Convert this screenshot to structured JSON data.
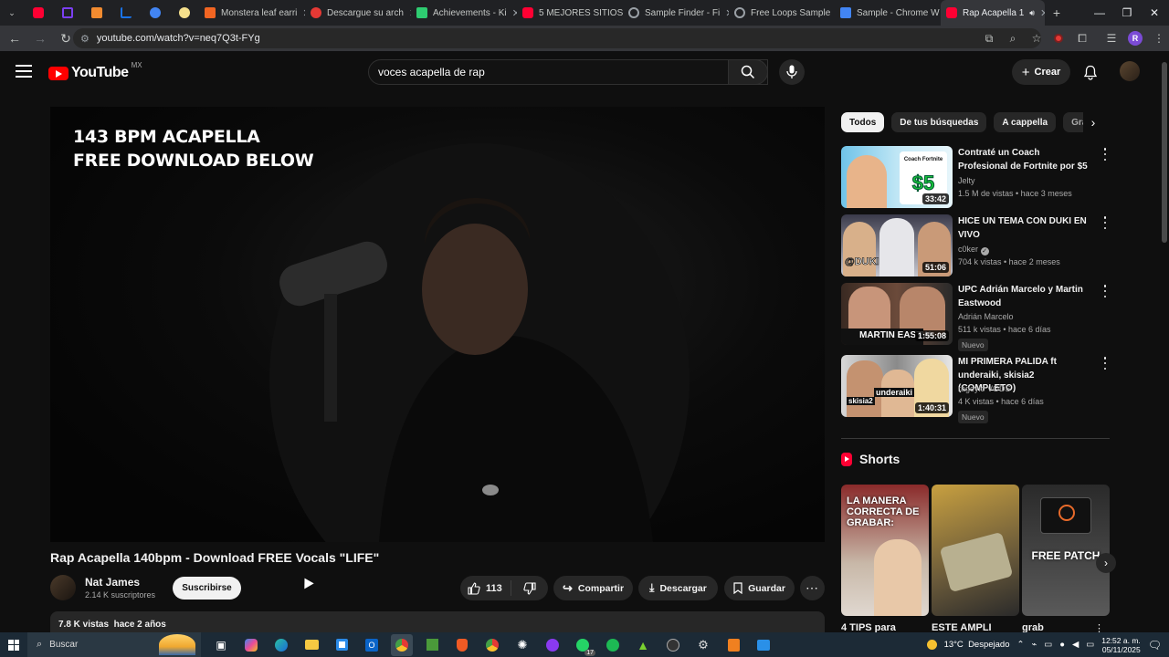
{
  "browser": {
    "tabs": [
      {
        "label": "",
        "pinned": true,
        "color": "#ff0033"
      },
      {
        "label": "",
        "pinned": true,
        "color": "#7b3ff2"
      },
      {
        "label": "",
        "pinned": true,
        "color": "#f28b30"
      },
      {
        "label": "",
        "pinned": true,
        "color": "#1a73e8"
      },
      {
        "label": "",
        "pinned": true,
        "color": "#4285f4"
      },
      {
        "label": "",
        "pinned": true,
        "color": "#f5e08c"
      },
      {
        "label": "Monstera leaf earri",
        "pinned": false,
        "color": "#f26522"
      },
      {
        "label": "Descargue su arch",
        "pinned": false,
        "color": "#e53935"
      },
      {
        "label": "Achievements - Ki",
        "pinned": false,
        "color": "#2ecc71"
      },
      {
        "label": "5 MEJORES SITIOS",
        "pinned": false,
        "color": "#ff0033"
      },
      {
        "label": "Sample Finder - Fi",
        "pinned": false,
        "color": "#9aa0a6"
      },
      {
        "label": "Free Loops Sample",
        "pinned": false,
        "color": "#9aa0a6"
      },
      {
        "label": "Sample - Chrome W",
        "pinned": false,
        "color": "#4285f4"
      },
      {
        "label": "Rap Acapella 1",
        "pinned": false,
        "color": "#ff0033",
        "active": true
      }
    ],
    "new_tab": "+",
    "url": "youtube.com/watch?v=neq7Q3t-FYg",
    "profile_initial": "R"
  },
  "youtube": {
    "logo": "YouTube",
    "country": "MX",
    "search_query": "voces acapella de rap",
    "create_label": "Crear"
  },
  "video": {
    "overlay_line1": "143 BPM ACAPELLA",
    "overlay_line2": "FREE DOWNLOAD BELOW",
    "title": "Rap Acapella 140bpm - Download FREE Vocals \"LIFE\"",
    "channel": "Nat James",
    "subscribers": "2.14 K suscriptores",
    "subscribe_label": "Suscribirse",
    "likes": "113",
    "share_label": "Compartir",
    "download_label": "Descargar",
    "save_label": "Guardar",
    "views_date": "7.8 K vistas  hace 2 años"
  },
  "chips": [
    "Todos",
    "De tus búsquedas",
    "A cappella",
    "Gra"
  ],
  "related": [
    {
      "title": "Contraté un Coach Profesional de Fortnite por $5",
      "channel": "Jelty",
      "meta": "1.5 M de vistas • hace 3 meses",
      "duration": "33:42",
      "badge": "",
      "verified": false
    },
    {
      "title": "HICE UN TEMA CON DUKI EN VIVO",
      "channel": "c0ker",
      "meta": "704 k vistas • hace 2 meses",
      "duration": "51:06",
      "badge": "",
      "verified": true
    },
    {
      "title": "UPC Adrián Marcelo y Martin Eastwood",
      "channel": "Adrián Marcelo",
      "meta": "511 k vistas • hace 6 días",
      "duration": "1:55:08",
      "badge": "Nuevo",
      "verified": false
    },
    {
      "title": "MI PRIMERA PALIDA ft underaiki, skisia2 (COMPLETO)",
      "channel": "rageylo VODS",
      "meta": "4 K vistas • hace 6 días",
      "duration": "1:40:31",
      "badge": "Nuevo",
      "verified": false
    }
  ],
  "thumb_texts": {
    "t1": "$5",
    "t1_top": "Coach Fortnite",
    "t2": "@DUKI",
    "t3": "MARTIN EASTW",
    "t4a": "underaiki",
    "t4b": "skisia2"
  },
  "shorts": {
    "heading": "Shorts",
    "items": [
      {
        "caption": "4 TIPS para",
        "overlay": "LA MANERA CORRECTA DE GRABAR:"
      },
      {
        "caption": "ESTE AMPLI",
        "overlay": ""
      },
      {
        "caption": "grab",
        "overlay": "FREE PATCH"
      }
    ]
  },
  "taskbar": {
    "search_label": "Buscar",
    "weather": "13°C  Despejado",
    "time": "12:52 a. m.",
    "date": "05/11/2025",
    "badge_count": "17"
  }
}
